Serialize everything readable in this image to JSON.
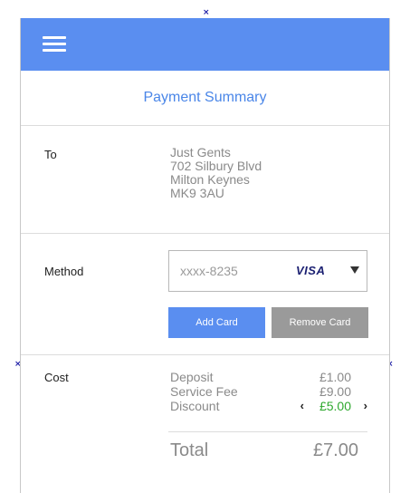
{
  "markers": [
    "×",
    "×",
    "×"
  ],
  "appbar": {
    "menu_icon": "hamburger-menu-icon",
    "color": "#5a8ef0"
  },
  "page_title": "Payment Summary",
  "to": {
    "label": "To",
    "address_lines": [
      "Just Gents",
      "702 Silbury Blvd",
      "Milton Keynes",
      "MK9 3AU"
    ]
  },
  "method": {
    "label": "Method",
    "card_number": "xxxx-8235",
    "card_brand": "VISA",
    "add_card_label": "Add Card",
    "remove_card_label": "Remove Card"
  },
  "cost": {
    "label": "Cost",
    "lines": [
      {
        "name": "Deposit",
        "amount": "£1.00"
      },
      {
        "name": "Service Fee",
        "amount": "£9.00"
      },
      {
        "name": "Discount",
        "amount": "£5.00"
      }
    ],
    "prev_glyph": "‹",
    "next_glyph": "›",
    "total_label": "Total",
    "total_amount": "£7.00"
  },
  "colors": {
    "accent": "#5a8ef0",
    "title": "#4a86e8",
    "discount": "#2fa82f",
    "secondary_button": "#9a9a9a"
  }
}
